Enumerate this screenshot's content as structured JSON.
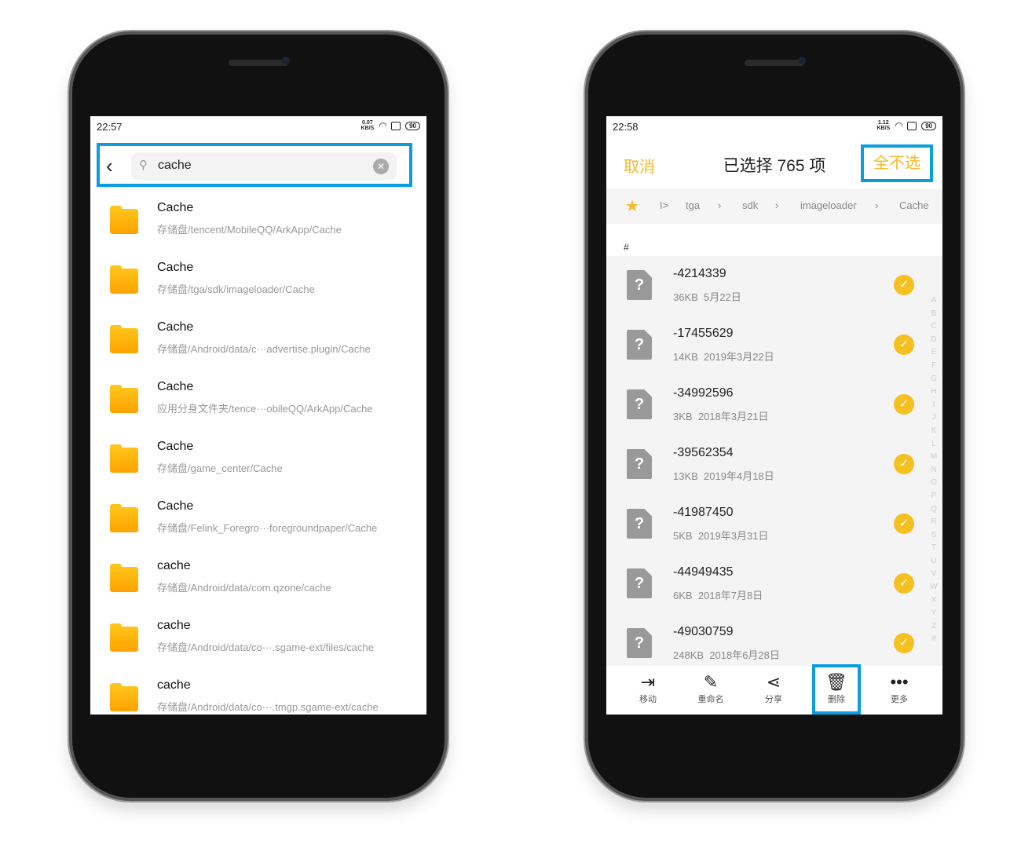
{
  "left": {
    "status": {
      "time": "22:57",
      "speed": "0.07 KB/S",
      "battery": "90"
    },
    "search": {
      "value": "cache"
    },
    "results": [
      {
        "name": "Cache",
        "path": "存储盘/tencent/MobileQQ/ArkApp/Cache"
      },
      {
        "name": "Cache",
        "path": "存储盘/tga/sdk/imageloader/Cache"
      },
      {
        "name": "Cache",
        "path": "存储盘/Android/data/c···advertise.plugin/Cache"
      },
      {
        "name": "Cache",
        "path": "应用分身文件夹/tence···obileQQ/ArkApp/Cache"
      },
      {
        "name": "Cache",
        "path": "存储盘/game_center/Cache"
      },
      {
        "name": "Cache",
        "path": "存储盘/Felink_Foregro···foregroundpaper/Cache"
      },
      {
        "name": "cache",
        "path": "存储盘/Android/data/com.qzone/cache"
      },
      {
        "name": "cache",
        "path": "存储盘/Android/data/co···.sgame-ext/files/cache"
      },
      {
        "name": "cache",
        "path": "存储盘/Android/data/co···.tmgp.sgame-ext/cache"
      }
    ]
  },
  "right": {
    "status": {
      "time": "22:58",
      "speed": "1.12 KB/S",
      "battery": "90"
    },
    "cancel": "取消",
    "title": "已选择 765 项",
    "deselect_all": "全不选",
    "breadcrumb": [
      "tga",
      "sdk",
      "imageloader",
      "Cache"
    ],
    "section": "#",
    "files": [
      {
        "name": "-4214339",
        "size": "36KB",
        "date": "5月22日"
      },
      {
        "name": "-17455629",
        "size": "14KB",
        "date": "2019年3月22日"
      },
      {
        "name": "-34992596",
        "size": "3KB",
        "date": "2018年3月21日"
      },
      {
        "name": "-39562354",
        "size": "13KB",
        "date": "2019年4月18日"
      },
      {
        "name": "-41987450",
        "size": "5KB",
        "date": "2019年3月31日"
      },
      {
        "name": "-44949435",
        "size": "6KB",
        "date": "2018年7月8日"
      },
      {
        "name": "-49030759",
        "size": "248KB",
        "date": "2018年6月28日"
      }
    ],
    "index": "ABCDEFGHIJKLMNOPQRSTUVWXYZ#",
    "actions": [
      {
        "label": "移动",
        "icon": "move-icon"
      },
      {
        "label": "重命名",
        "icon": "rename-icon"
      },
      {
        "label": "分享",
        "icon": "share-icon"
      },
      {
        "label": "删除",
        "icon": "trash-icon"
      },
      {
        "label": "更多",
        "icon": "more-icon"
      }
    ]
  },
  "colors": {
    "accent": "#f5b923",
    "highlight": "#0a9de0"
  }
}
